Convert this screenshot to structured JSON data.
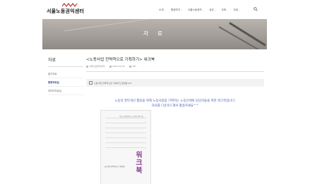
{
  "header": {
    "logo_text": "서울노동권익센터",
    "brand_color": "#4b63b6",
    "nav": [
      {
        "label": "소개",
        "has_dropdown": true
      },
      {
        "label": "활동하기",
        "has_dropdown": true
      },
      {
        "label": "서울노동정보",
        "has_dropdown": true
      },
      {
        "label": "상담",
        "has_dropdown": true
      },
      {
        "label": "교육",
        "has_dropdown": true
      },
      {
        "label": "자료",
        "has_dropdown": true
      }
    ],
    "search_icon": "search-icon"
  },
  "banner": {
    "title": "자 료"
  },
  "sidebar": {
    "title": "자료",
    "items": [
      {
        "label": "발간자료",
        "active": false
      },
      {
        "label": "법령자료실",
        "active": true
      },
      {
        "label": "데이터자료실",
        "active": false
      }
    ]
  },
  "post": {
    "title": "<노동사업 전략적으로 기획하기> 워크북",
    "meta": {
      "author": "서울노동권익센터",
      "date": "2020-00-00",
      "views": "383"
    },
    "attachment": "노동사업 전략적으로 기획하기_완성본.pdf",
    "notice_line1": "노동의 권익개선 활동을 위해 노동사업을 기획하는 노동단체와 담당자들을 위한 워크북입니다.",
    "notice_line2": "자료를 다운로드해서 활용하세요^^",
    "cover": {
      "header": "서울노동권익센터 노동사업 전략기획",
      "subtitle": "노동사업 전략적으로 기획하기",
      "big_text": "워크북",
      "accent_color": "#8b3e95"
    }
  }
}
